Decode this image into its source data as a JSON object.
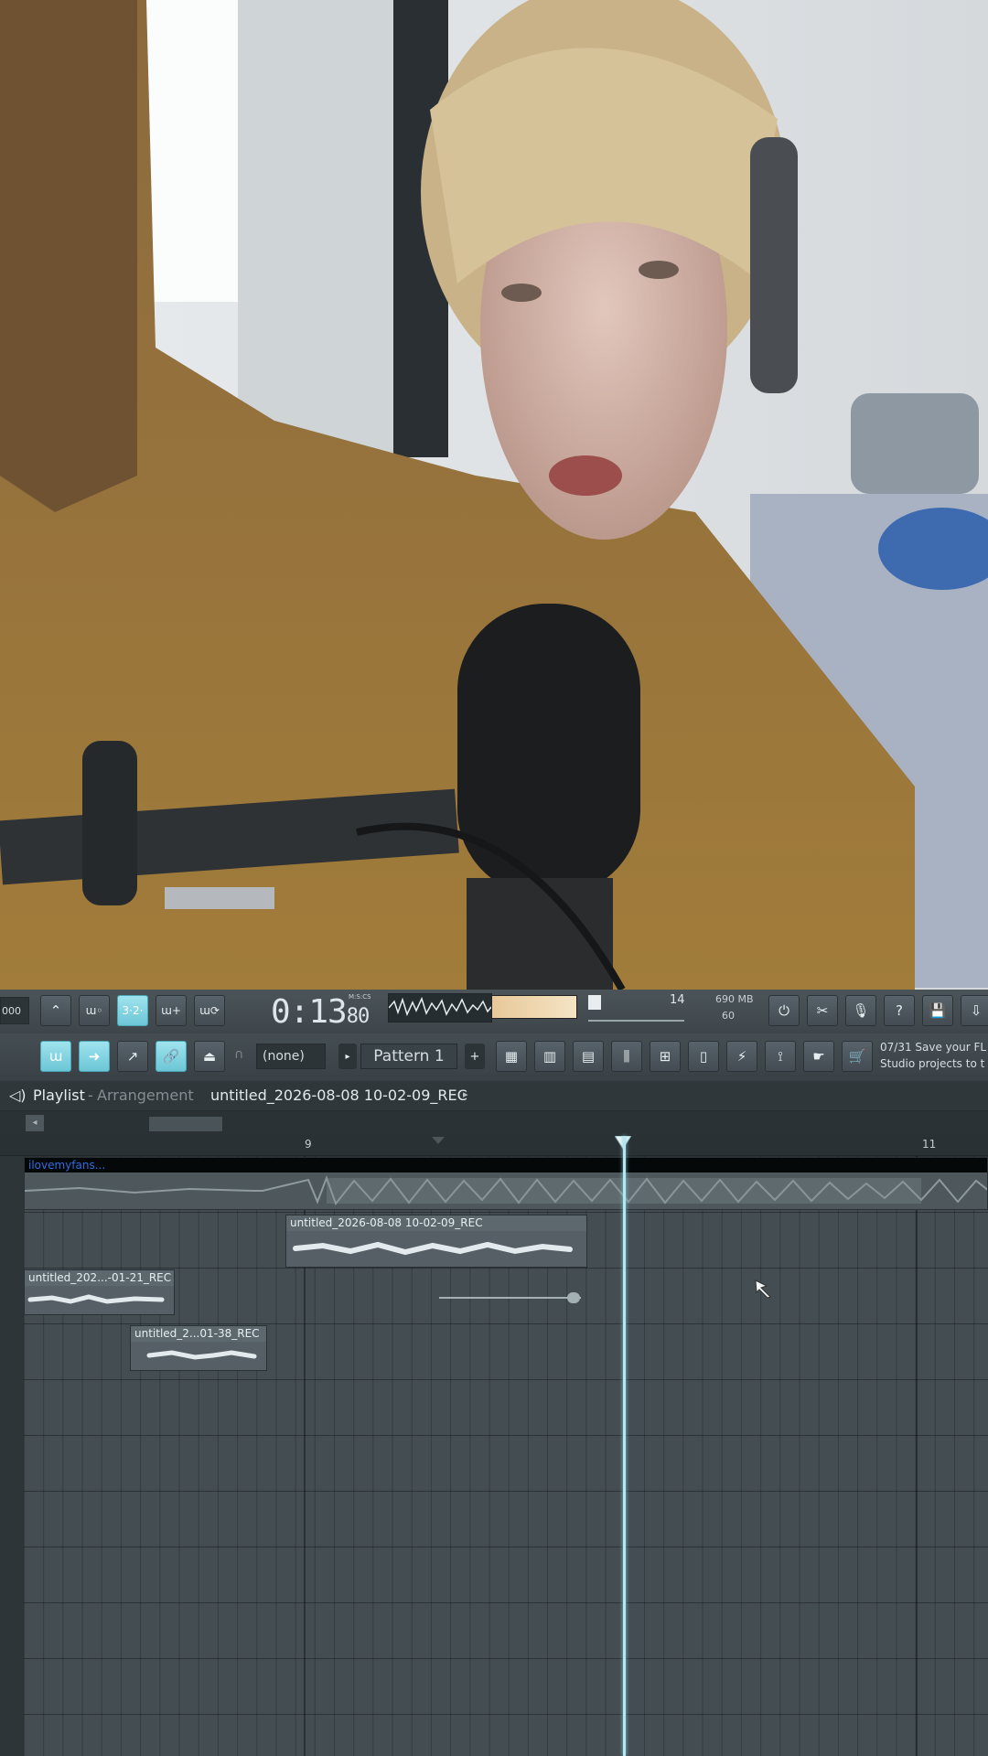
{
  "toolbar": {
    "left_value": "000",
    "song_time": "0:13",
    "song_time_small": "80",
    "time_unit": "M:S:CS",
    "cpu_value": "14",
    "memory": "690 MB",
    "polyphony": "60",
    "snap_select": "(none)",
    "pattern_select": "Pattern 1",
    "hint_line1": "07/31  Save your FL",
    "hint_line2": "Studio projects to t"
  },
  "playlist": {
    "title": "Playlist",
    "separator": "-",
    "subtitle": "Arrangement",
    "file": "untitled_2026-08-08 10-02-09_REC",
    "ruler": [
      "9",
      "11"
    ],
    "clips": [
      {
        "label": "ilovemyfans..."
      },
      {
        "label": "untitled_2026-08-08 10-02-09_REC"
      },
      {
        "label": "untitled_202...-01-21_REC"
      },
      {
        "label": "untitled_2...01-38_REC"
      }
    ]
  },
  "colors": {
    "accent": "#7fd3e3",
    "panel": "#3b4449",
    "grid": "#434d52"
  }
}
